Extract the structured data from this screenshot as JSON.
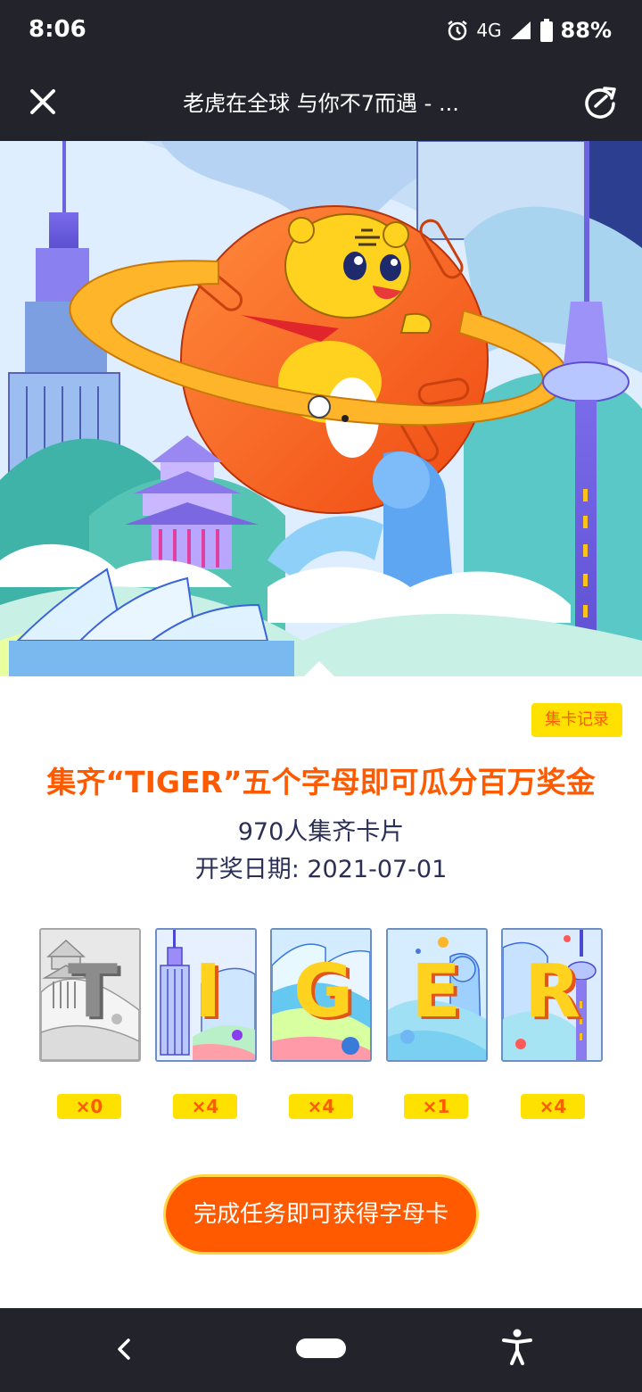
{
  "status_bar": {
    "time": "8:06",
    "network": "4G",
    "battery": "88%",
    "icons": [
      "alarm-icon",
      "signal-icon",
      "battery-icon"
    ]
  },
  "header": {
    "title": "老虎在全球 与你不7而遇 - ...",
    "icons": [
      "close-icon",
      "refresh-icon"
    ]
  },
  "banner": {
    "icons": [
      "tiger-mascot",
      "planet",
      "empire-state-building",
      "pagoda",
      "merlion",
      "sky-tower",
      "opera-house"
    ]
  },
  "card_record_label": "集卡记录",
  "main_title": "集齐“TIGER”五个字母即可瓜分百万奖金",
  "collect_count": "970人集齐卡片",
  "draw_date": "开奖日期: 2021-07-01",
  "letters": [
    {
      "letter": "T",
      "count": "×0",
      "collected": false
    },
    {
      "letter": "I",
      "count": "×4",
      "collected": true
    },
    {
      "letter": "G",
      "count": "×4",
      "collected": true
    },
    {
      "letter": "E",
      "count": "×1",
      "collected": true
    },
    {
      "letter": "R",
      "count": "×4",
      "collected": true
    }
  ],
  "task_button": "完成任务即可获得字母卡",
  "colors": {
    "accent": "#ff5a00",
    "badge": "#ffe100",
    "bar": "#23232b",
    "text_dark": "#2b2f55"
  },
  "nav_bar": {
    "icons": [
      "back-icon",
      "home-pill",
      "accessibility-icon"
    ]
  }
}
